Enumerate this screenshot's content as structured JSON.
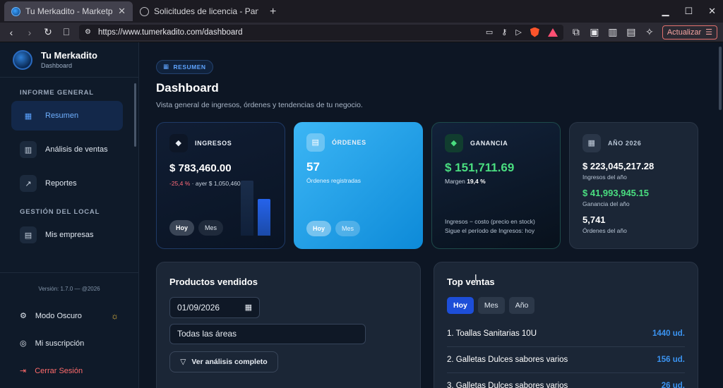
{
  "browser": {
    "tabs": [
      {
        "title": "Tu Merkadito - Marketplac"
      },
      {
        "title": "Solicitudes de licencia - Panel"
      }
    ],
    "url": "https://www.tumerkadito.com/dashboard",
    "update_label": "Actualizar"
  },
  "sidebar": {
    "brand_name": "Tu Merkadito",
    "brand_sub": "Dashboard",
    "section1": "INFORME GENERAL",
    "items1": [
      {
        "label": "Resumen"
      },
      {
        "label": "Análisis de ventas"
      },
      {
        "label": "Reportes"
      }
    ],
    "section2": "GESTIÓN DEL LOCAL",
    "items2": [
      {
        "label": "Mis empresas"
      }
    ],
    "version": "Versión: 1.7.0 — @2026",
    "dark_mode": "Modo Oscuro",
    "subscription": "Mi suscripción",
    "logout": "Cerrar Sesión"
  },
  "header": {
    "pill": "RESUMEN",
    "title": "Dashboard",
    "subtitle": "Vista general de ingresos, órdenes y tendencias de tu negocio."
  },
  "cards": {
    "ingresos": {
      "label": "INGRESOS",
      "value": "$ 783,460.00",
      "change": "-25,4 %",
      "prev": " · ayer $ 1,050,460.00",
      "toggle": [
        "Hoy",
        "Mes"
      ]
    },
    "ordenes": {
      "label": "ÓRDENES",
      "value": "57",
      "sub": "Órdenes registradas",
      "toggle": [
        "Hoy",
        "Mes"
      ]
    },
    "ganancia": {
      "label": "GANANCIA",
      "value": "$ 151,711.69",
      "margin_label": "Margen ",
      "margin_value": "19,4 %",
      "note1": "Ingresos − costo (precio en stock)",
      "note2": "Sigue el período de Ingresos: hoy"
    },
    "anio": {
      "label": "AÑO 2026",
      "rows": [
        {
          "value": "$ 223,045,217.28",
          "label": "Ingresos del año"
        },
        {
          "value": "$ 41,993,945.15",
          "label": "Ganancia del año"
        },
        {
          "value": "5,741",
          "label": "Órdenes del año"
        }
      ]
    }
  },
  "productos": {
    "title": "Productos vendidos",
    "date": "01/09/2026",
    "area": "Todas las áreas",
    "button": "Ver análisis completo"
  },
  "top_ventas": {
    "title": "Top ventas",
    "seg": [
      "Hoy",
      "Mes",
      "Año"
    ],
    "items": [
      {
        "name": "1. Toallas Sanitarias 10U",
        "qty": "1440 ud."
      },
      {
        "name": "2. Galletas Dulces sabores varios",
        "qty": "156 ud."
      },
      {
        "name": "3. Galletas Dulces sabores varios",
        "qty": "26 ud."
      }
    ]
  }
}
